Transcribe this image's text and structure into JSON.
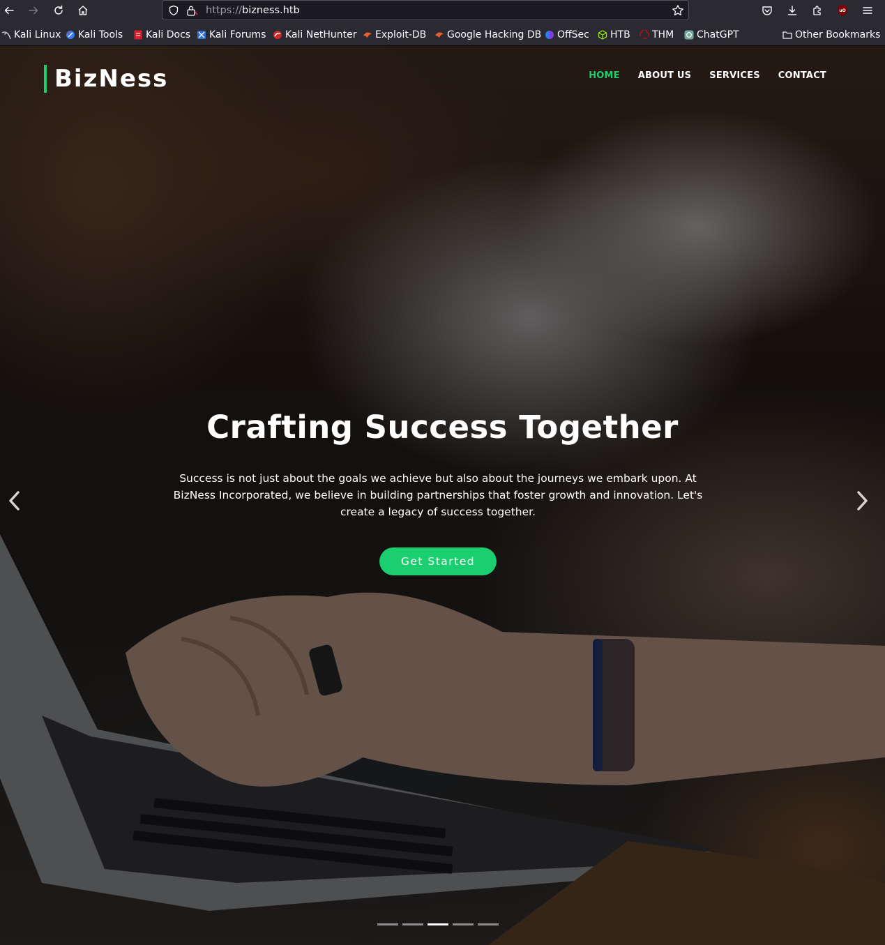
{
  "browser": {
    "url_scheme": "https://",
    "url_host": "bizness.htb",
    "icons": [
      "back-arrow-icon",
      "forward-arrow-icon",
      "reload-icon",
      "home-icon",
      "shield-icon",
      "lock-icon",
      "star-icon",
      "pocket-icon",
      "download-icon",
      "extensions-icon",
      "ublock-icon",
      "menu-icon"
    ]
  },
  "bookmarks": {
    "items": [
      {
        "label": "Kali Linux",
        "icon": "kali-dragon-icon"
      },
      {
        "label": "Kali Tools",
        "icon": "kali-tools-icon"
      },
      {
        "label": "Kali Docs",
        "icon": "kali-docs-icon"
      },
      {
        "label": "Kali Forums",
        "icon": "kali-forums-icon"
      },
      {
        "label": "Kali NetHunter",
        "icon": "nethunter-icon"
      },
      {
        "label": "Exploit-DB",
        "icon": "exploit-db-icon"
      },
      {
        "label": "Google Hacking DB",
        "icon": "ghdb-icon"
      },
      {
        "label": "OffSec",
        "icon": "offsec-icon"
      },
      {
        "label": "HTB",
        "icon": "htb-cube-icon"
      },
      {
        "label": "THM",
        "icon": "thm-icon"
      },
      {
        "label": "ChatGPT",
        "icon": "chatgpt-icon"
      }
    ],
    "other": "Other Bookmarks"
  },
  "site": {
    "brand": "BizNess",
    "nav": {
      "home": "HOME",
      "about": "ABOUT US",
      "services": "SERVICES",
      "contact": "CONTACT"
    },
    "hero": {
      "title": "Crafting Success Together",
      "text": "Success is not just about the goals we achieve but also about the journeys we embark upon. At BizNess Incorporated, we believe in building partnerships that foster growth and innovation. Let's create a legacy of success together.",
      "cta": "Get Started",
      "slides_total": 5,
      "active_slide": 3
    },
    "colors": {
      "accent": "#1bce6f",
      "toolbar": "#2b2a33",
      "urlbar": "#1c1b22"
    }
  }
}
